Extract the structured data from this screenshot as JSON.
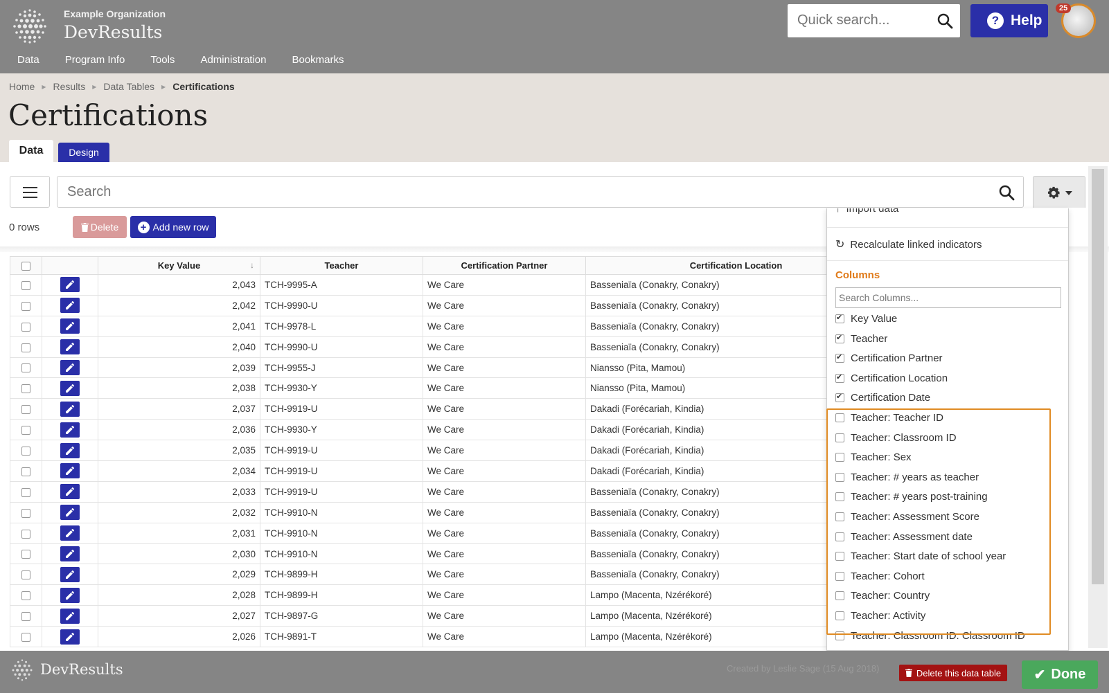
{
  "header": {
    "org_name": "Example Organization",
    "app_name": "DevResults",
    "quick_search_placeholder": "Quick search...",
    "help_label": "Help",
    "notification_count": "25"
  },
  "nav": {
    "items": [
      "Data",
      "Program Info",
      "Tools",
      "Administration",
      "Bookmarks"
    ]
  },
  "breadcrumb": {
    "items": [
      "Home",
      "Results",
      "Data Tables"
    ],
    "current": "Certifications"
  },
  "page": {
    "title": "Certifications",
    "tab_data": "Data",
    "tab_design": "Design"
  },
  "toolbar": {
    "search_placeholder": "Search",
    "rows_count": "0 rows",
    "delete_label": "Delete",
    "add_label": "Add new row"
  },
  "table": {
    "headers": [
      "Key Value",
      "Teacher",
      "Certification Partner",
      "Certification Location"
    ],
    "rows": [
      [
        "2,043",
        "TCH-9995-A",
        "We Care",
        "Basseniaïa (Conakry, Conakry)"
      ],
      [
        "2,042",
        "TCH-9990-U",
        "We Care",
        "Basseniaïa (Conakry, Conakry)"
      ],
      [
        "2,041",
        "TCH-9978-L",
        "We Care",
        "Basseniaïa (Conakry, Conakry)"
      ],
      [
        "2,040",
        "TCH-9990-U",
        "We Care",
        "Basseniaïa (Conakry, Conakry)"
      ],
      [
        "2,039",
        "TCH-9955-J",
        "We Care",
        "Niansso (Pita, Mamou)"
      ],
      [
        "2,038",
        "TCH-9930-Y",
        "We Care",
        "Niansso (Pita, Mamou)"
      ],
      [
        "2,037",
        "TCH-9919-U",
        "We Care",
        "Dakadi (Forécariah, Kindia)"
      ],
      [
        "2,036",
        "TCH-9930-Y",
        "We Care",
        "Dakadi (Forécariah, Kindia)"
      ],
      [
        "2,035",
        "TCH-9919-U",
        "We Care",
        "Dakadi (Forécariah, Kindia)"
      ],
      [
        "2,034",
        "TCH-9919-U",
        "We Care",
        "Dakadi (Forécariah, Kindia)"
      ],
      [
        "2,033",
        "TCH-9919-U",
        "We Care",
        "Basseniaïa (Conakry, Conakry)"
      ],
      [
        "2,032",
        "TCH-9910-N",
        "We Care",
        "Basseniaïa (Conakry, Conakry)"
      ],
      [
        "2,031",
        "TCH-9910-N",
        "We Care",
        "Basseniaïa (Conakry, Conakry)"
      ],
      [
        "2,030",
        "TCH-9910-N",
        "We Care",
        "Basseniaïa (Conakry, Conakry)"
      ],
      [
        "2,029",
        "TCH-9899-H",
        "We Care",
        "Basseniaïa (Conakry, Conakry)"
      ],
      [
        "2,028",
        "TCH-9899-H",
        "We Care",
        "Lampo (Macenta, Nzérékoré)"
      ],
      [
        "2,027",
        "TCH-9897-G",
        "We Care",
        "Lampo (Macenta, Nzérékoré)"
      ],
      [
        "2,026",
        "TCH-9891-T",
        "We Care",
        "Lampo (Macenta, Nzérékoré)"
      ]
    ]
  },
  "dropdown": {
    "import_label": "Import data",
    "recalc_label": "Recalculate linked indicators",
    "columns_heading": "Columns",
    "columns_search_placeholder": "Search Columns...",
    "columns": [
      {
        "label": "Key Value",
        "checked": true
      },
      {
        "label": "Teacher",
        "checked": true
      },
      {
        "label": "Certification Partner",
        "checked": true
      },
      {
        "label": "Certification Location",
        "checked": true
      },
      {
        "label": "Certification Date",
        "checked": true
      },
      {
        "label": "Teacher: Teacher ID",
        "checked": false
      },
      {
        "label": "Teacher: Classroom ID",
        "checked": false
      },
      {
        "label": "Teacher: Sex",
        "checked": false
      },
      {
        "label": "Teacher: # years as teacher",
        "checked": false
      },
      {
        "label": "Teacher: # years post-training",
        "checked": false
      },
      {
        "label": "Teacher: Assessment Score",
        "checked": false
      },
      {
        "label": "Teacher: Assessment date",
        "checked": false
      },
      {
        "label": "Teacher: Start date of school year",
        "checked": false
      },
      {
        "label": "Teacher: Cohort",
        "checked": false
      },
      {
        "label": "Teacher: Country",
        "checked": false
      },
      {
        "label": "Teacher: Activity",
        "checked": false
      },
      {
        "label": "Teacher: Classroom ID: Classroom ID",
        "checked": false
      }
    ]
  },
  "footer": {
    "app_name": "DevResults",
    "created_by": "Created by Leslie Sage (15 Aug 2018)",
    "delete_table_label": "Delete this data table",
    "done_label": "Done"
  },
  "colors": {
    "brand": "#2a2fa8",
    "header_grey": "#858585",
    "accent_orange": "#e08b23",
    "done_green": "#4aa85c",
    "danger_red": "#a31212"
  }
}
